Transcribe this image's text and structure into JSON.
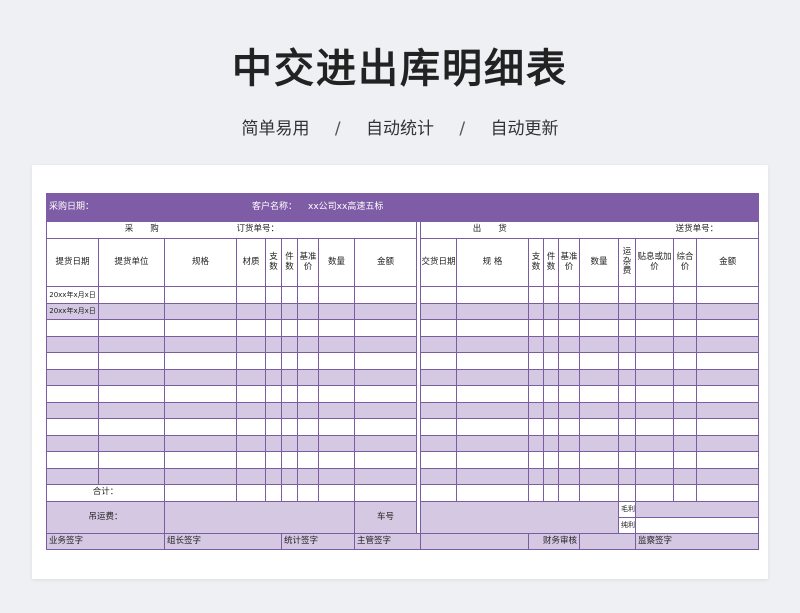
{
  "page": {
    "title": "中交进出库明细表",
    "subtitle": [
      "简单易用",
      "/",
      "自动统计",
      "/",
      "自动更新"
    ]
  },
  "sheet": {
    "header": {
      "purchase_date_label": "采购日期：",
      "customer_label": "客户名称：",
      "customer_value": "xx公司xx高速五标"
    },
    "purchase_section": {
      "title": "采　　购",
      "order_label": "订货单号："
    },
    "outgoing_section": {
      "title": "出　　货",
      "delivery_label": "送货单号："
    },
    "purchase_columns": [
      "提货日期",
      "提货单位",
      "规格",
      "材质",
      "支数",
      "件数",
      "基准价",
      "数量",
      "金额"
    ],
    "outgoing_columns": [
      "交货日期",
      "规 格",
      "支数",
      "件数",
      "基准价",
      "数量",
      "运杂费",
      "贴息或加价",
      "综合价",
      "金额"
    ],
    "rows": [
      {
        "date": "20xx年x月x日"
      },
      {
        "date": "20xx年x月x日"
      },
      {
        "date": ""
      },
      {
        "date": ""
      },
      {
        "date": ""
      },
      {
        "date": ""
      },
      {
        "date": ""
      },
      {
        "date": ""
      },
      {
        "date": ""
      },
      {
        "date": ""
      },
      {
        "date": ""
      },
      {
        "date": ""
      }
    ],
    "total_label": "合计：",
    "crane_fee_label": "吊运费：",
    "car_no_label": "车号",
    "gross_profit_label": "毛利",
    "net_profit_label": "纯利",
    "signatures": [
      "业务签字",
      "组长签字",
      "统计签字",
      "主管签字",
      "财务审核",
      "监察签字"
    ]
  }
}
